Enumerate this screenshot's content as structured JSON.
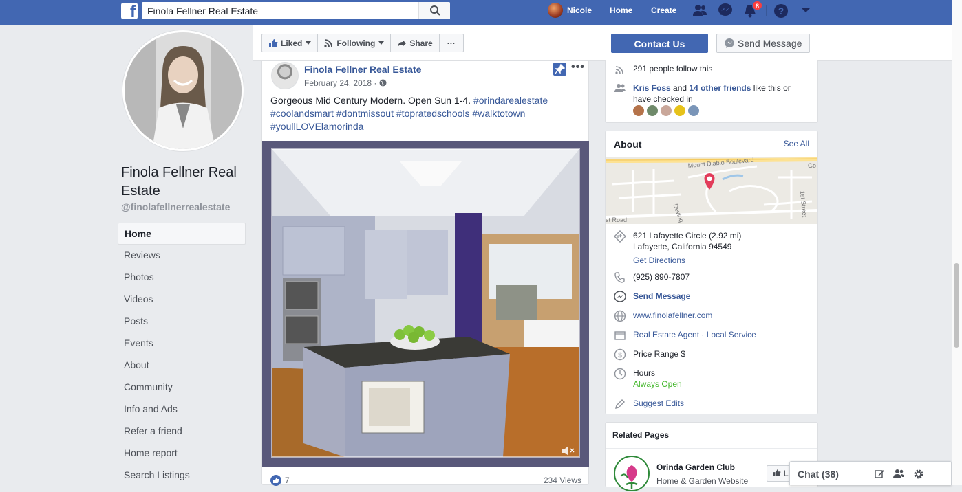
{
  "topbar": {
    "search_value": "Finola Fellner Real Estate",
    "user_name": "Nicole",
    "nav_home": "Home",
    "nav_create": "Create",
    "notification_count": "8",
    "icons": [
      "facebook-logo",
      "search-icon",
      "friends-icon",
      "messenger-icon",
      "notifications-icon",
      "help-icon",
      "caret-down-icon"
    ]
  },
  "pagebar": {
    "liked_label": "Liked",
    "following_label": "Following",
    "share_label": "Share",
    "more_label": "···",
    "contact_label": "Contact Us",
    "send_message_label": "Send Message"
  },
  "left": {
    "page_name": "Finola Fellner Real Estate",
    "handle": "@finolafellnerrealestate",
    "nav": [
      "Home",
      "Reviews",
      "Photos",
      "Videos",
      "Posts",
      "Events",
      "About",
      "Community",
      "Info and Ads",
      "Refer a friend",
      "Home report",
      "Search Listings"
    ],
    "active": "Home"
  },
  "post": {
    "author": "Finola Fellner Real Estate",
    "date": "February 24, 2018 · ",
    "text_plain": "Gorgeous Mid Century Modern. Open Sun 1-4. ",
    "hashtag1": "#orindarealestate",
    "hashtag2": "#coolandsmart",
    "hashtag3": "#dontmissout",
    "hashtag4": "#topratedschools",
    "hashtag5": "#walktotown",
    "hashtag6": "#youllLOVElamorinda",
    "like_count": "7",
    "views": "234 Views"
  },
  "community": {
    "follow_text": "291 people follow this",
    "friend_name": "Kris Foss",
    "and_text": " and ",
    "others_link": "14 other friends",
    "like_text": " like this or have checked in"
  },
  "about": {
    "title": "About",
    "see_all": "See All",
    "map_labels": [
      "Mount Diablo Boulevard",
      "Deving A",
      "1st Street",
      "st Road",
      "Go"
    ],
    "address1": "621 Lafayette Circle (2.92 mi)",
    "address2": "Lafayette, California 94549",
    "directions": "Get Directions",
    "phone": "(925) 890-7807",
    "send_message": "Send Message",
    "website": "www.finolafellner.com",
    "category1": "Real Estate Agent",
    "category_sep": " · ",
    "category2": "Local Service",
    "price": "Price Range $",
    "hours_label": "Hours",
    "hours_value": "Always Open",
    "suggest": "Suggest Edits"
  },
  "related": {
    "title": "Related Pages",
    "name": "Orinda Garden Club",
    "type": "Home & Garden Website",
    "like_btn": "L"
  },
  "chat": {
    "label": "Chat (38)"
  },
  "colors": {
    "brand": "#4267b2",
    "link": "#385898",
    "open_green": "#42b72a",
    "badge_red": "#fa3e3e"
  }
}
